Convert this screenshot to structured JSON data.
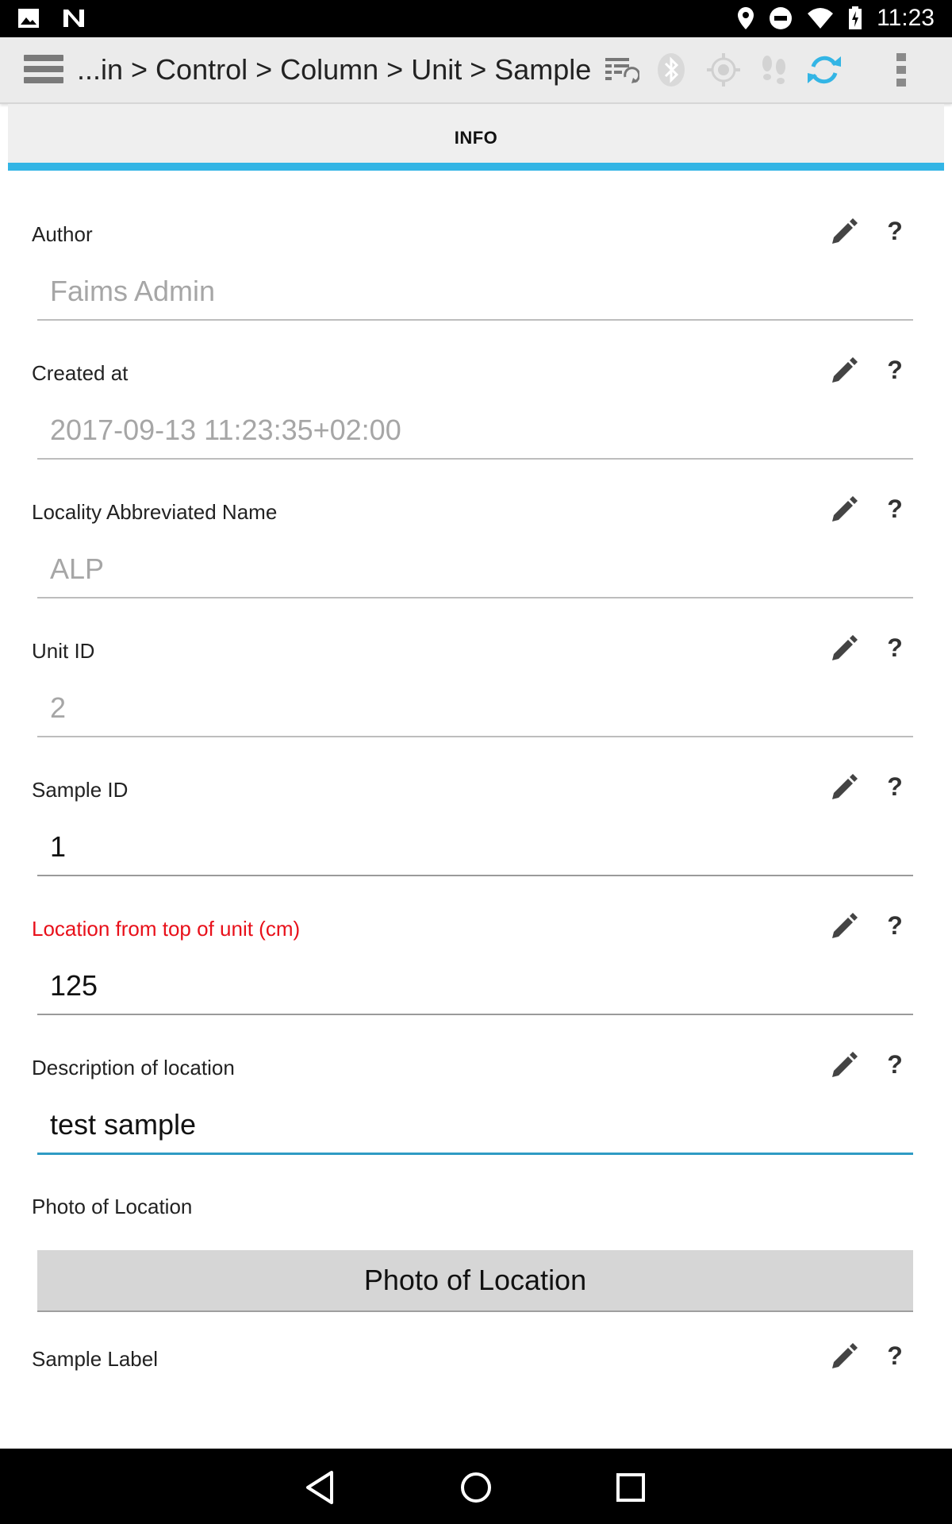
{
  "status_bar": {
    "time": "11:23",
    "icons": [
      "image-notification-icon",
      "n-logo-icon",
      "location-pin-icon",
      "do-not-disturb-icon",
      "wifi-icon",
      "battery-charging-icon"
    ]
  },
  "action_bar": {
    "breadcrumb": "...in > Control > Column > Unit > Sample",
    "icons": [
      "menu-icon",
      "sync-list-icon",
      "bluetooth-icon",
      "gps-icon",
      "tracker-footsteps-icon",
      "sync-icon",
      "overflow-menu-icon"
    ],
    "accent": "#33b5e5"
  },
  "tabs": [
    {
      "label": "INFO",
      "active": true
    }
  ],
  "fields": [
    {
      "label": "Author",
      "value": "Faims Admin",
      "readonly": true
    },
    {
      "label": "Created at",
      "value": "2017-09-13 11:23:35+02:00",
      "readonly": true
    },
    {
      "label": "Locality Abbreviated Name",
      "value": "ALP",
      "readonly": true
    },
    {
      "label": "Unit ID",
      "value": "2",
      "readonly": true
    },
    {
      "label": "Sample ID",
      "value": "1",
      "readonly": false
    },
    {
      "label": "Location from top of unit (cm)",
      "value": "125",
      "readonly": false,
      "required": true
    },
    {
      "label": "Description of location",
      "value": "test sample",
      "readonly": false,
      "focused": true
    }
  ],
  "photo": {
    "label": "Photo of Location",
    "button_label": "Photo of Location"
  },
  "sample_label": {
    "label": "Sample Label"
  },
  "help_glyph": "?",
  "colors": {
    "required_label": "#e8101a",
    "focus_underline": "#2f9bc4",
    "tab_indicator": "#33b5e5"
  }
}
